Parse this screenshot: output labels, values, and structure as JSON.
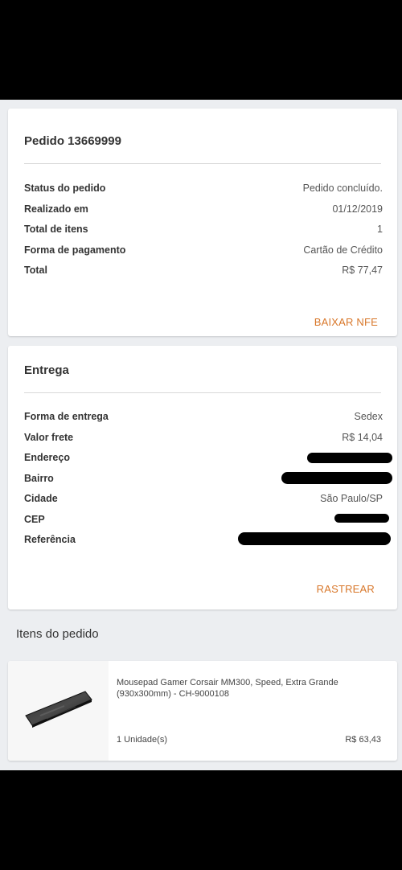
{
  "order": {
    "title": "Pedido 13669999",
    "rows": [
      {
        "label": "Status do pedido",
        "value": "Pedido concluído."
      },
      {
        "label": "Realizado em",
        "value": "01/12/2019"
      },
      {
        "label": "Total de itens",
        "value": "1"
      },
      {
        "label": "Forma de pagamento",
        "value": "Cartão de Crédito"
      },
      {
        "label": "Total",
        "value": "R$ 77,47"
      }
    ],
    "action_label": "BAIXAR NFE"
  },
  "delivery": {
    "title": "Entrega",
    "rows": [
      {
        "label": "Forma de entrega",
        "value": "Sedex"
      },
      {
        "label": "Valor frete",
        "value": "R$ 14,04"
      },
      {
        "label": "Endereço",
        "value": ""
      },
      {
        "label": "Bairro",
        "value": ""
      },
      {
        "label": "Cidade",
        "value": "São Paulo/SP"
      },
      {
        "label": "CEP",
        "value": ""
      },
      {
        "label": "Referência",
        "value": ""
      }
    ],
    "action_label": "RASTREAR"
  },
  "items_section": {
    "heading": "Itens do pedido",
    "items": [
      {
        "name": "Mousepad Gamer Corsair MM300, Speed, Extra Grande (930x300mm) - CH-9000108",
        "quantity": "1  Unidade(s)",
        "price": "R$ 63,43",
        "image_icon": "mousepad-image"
      }
    ]
  },
  "colors": {
    "accent": "#d8772a",
    "background": "#eceef1",
    "card": "#ffffff"
  }
}
